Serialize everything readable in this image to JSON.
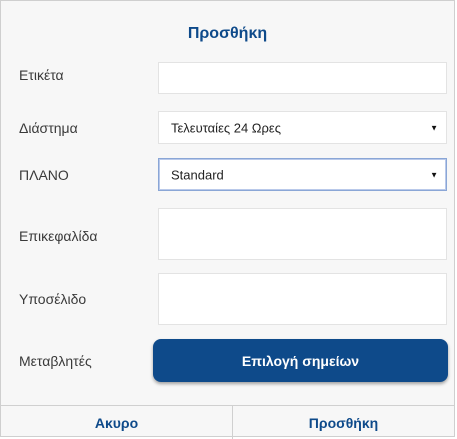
{
  "dialog": {
    "title": "Προσθήκη",
    "fields": {
      "label": {
        "label": "Ετικέτα",
        "value": ""
      },
      "interval": {
        "label": "Διάστημα",
        "selected": "Τελευταίες 24 Ωρες"
      },
      "plan": {
        "label": "ΠΛΑΝΟ",
        "selected": "Standard"
      },
      "header": {
        "label": "Επικεφαλίδα",
        "value": ""
      },
      "footer": {
        "label": "Υποσέλιδο",
        "value": ""
      },
      "variables": {
        "label": "Μεταβλητές",
        "button_label": "Επιλογή σημείων"
      }
    },
    "actions": {
      "cancel_label": "Ακυρο",
      "add_label": "Προσθήκη"
    }
  },
  "colors": {
    "accent": "#0e4a8a",
    "background": "#f7f7f7",
    "field_bg": "#ffffff"
  },
  "icons": {
    "dropdown": "chevron-down-icon"
  }
}
